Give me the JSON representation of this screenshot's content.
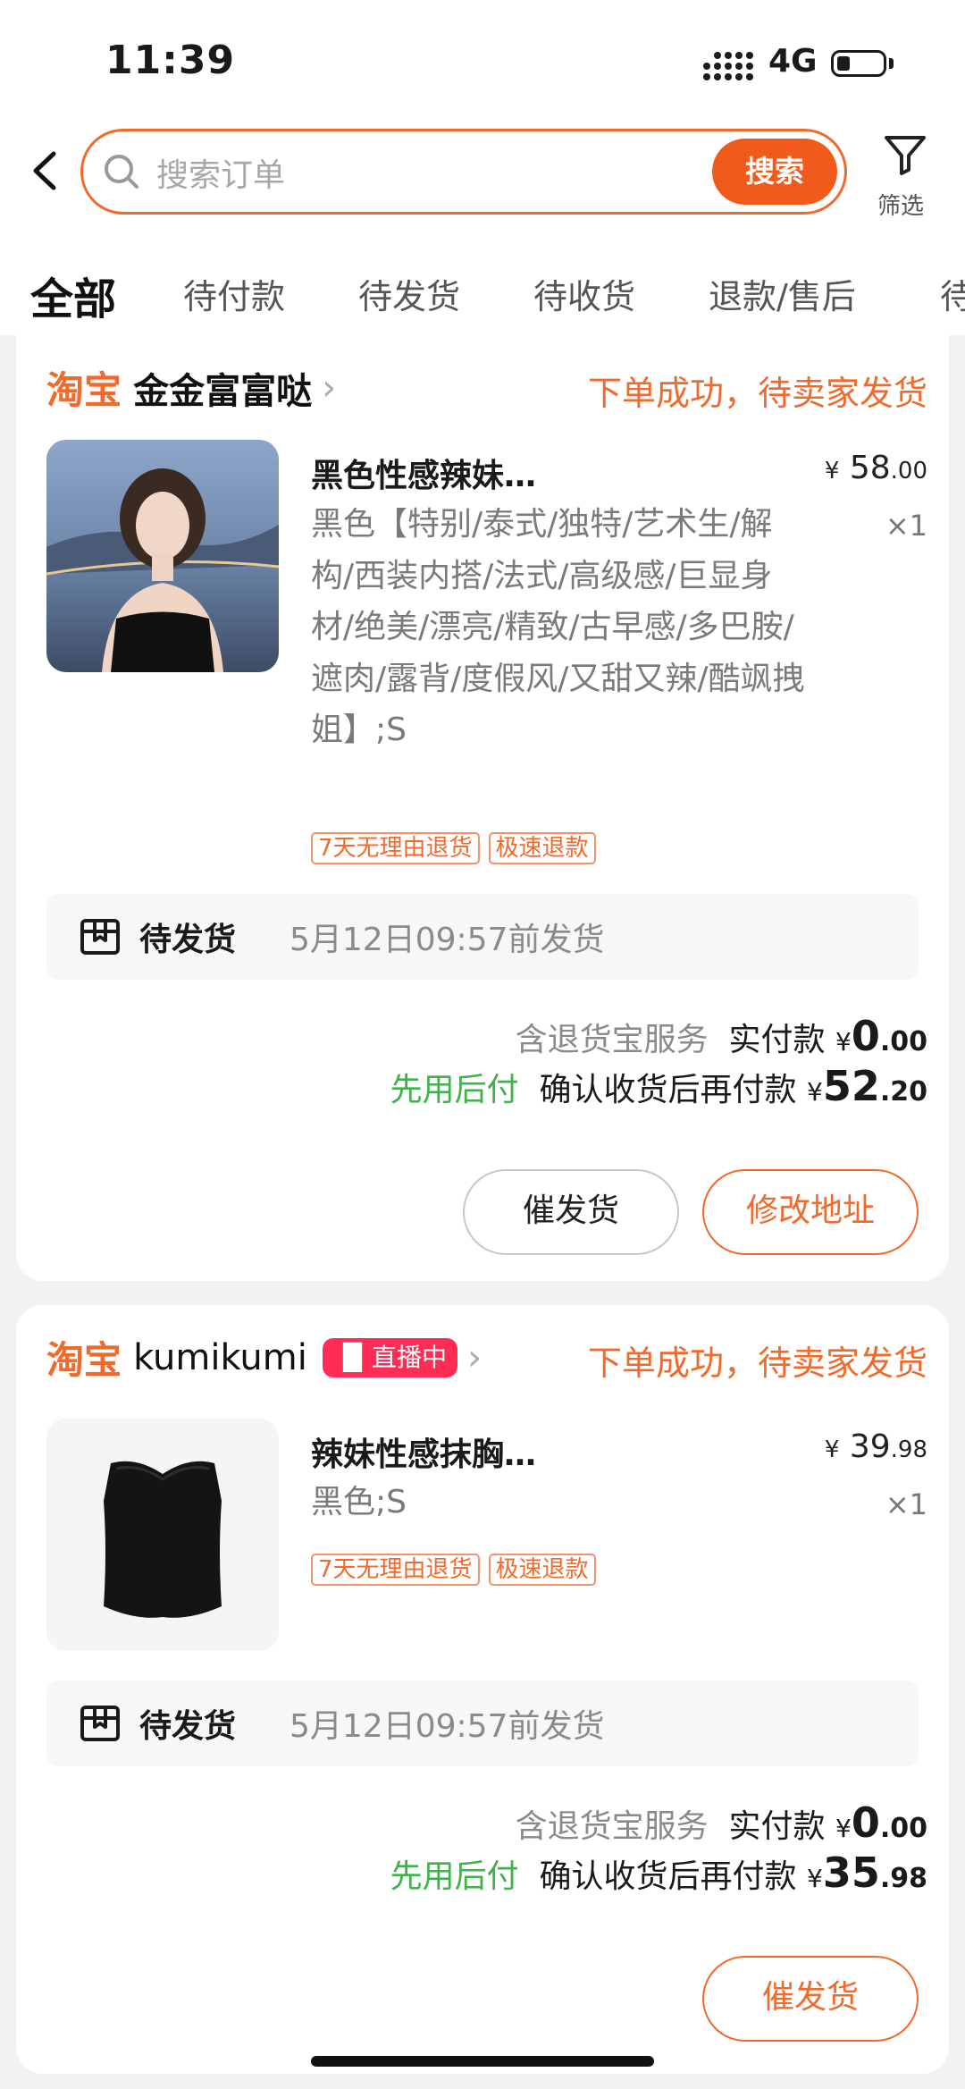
{
  "status_bar": {
    "time": "11:39",
    "network": "4G"
  },
  "search": {
    "placeholder": "搜索订单",
    "button": "搜索"
  },
  "filter_label": "筛选",
  "tabs": [
    "全部",
    "待付款",
    "待发货",
    "待收货",
    "退款/售后",
    "待"
  ],
  "orders": [
    {
      "platform": "淘宝",
      "shop": "金金富富哒",
      "live_badge": "",
      "status": "下单成功，待卖家发货",
      "title": "黑色性感辣妹抹胸背心女夏季",
      "price_currency": "¥",
      "price_int": "58",
      "price_dec": ".00",
      "qty": "×1",
      "sku": "黑色【特别/泰式/独特/艺术生/解构/西装内搭/法式/高级感/巨显身材/绝美/漂亮/精致/古早感/多巴胺/遮肉/露背/度假风/又甜又辣/酷飒拽姐】;S",
      "tags": [
        "7天无理由退货",
        "极速退款"
      ],
      "ship_status": "待发货",
      "ship_deadline": "5月12日09:57前发货",
      "service_note": "含退货宝服务",
      "paid_label": "实付款",
      "paid_int": "0",
      "paid_dec": ".00",
      "later_pay": "先用后付",
      "later_label": "确认收货后再付款",
      "later_int": "52",
      "later_dec": ".20",
      "buttons": [
        "催发货",
        "修改地址"
      ]
    },
    {
      "platform": "淘宝",
      "shop": "kumikumi",
      "live_badge": "直播中",
      "status": "下单成功，待卖家发货",
      "title": "辣妹性感抹胸黑色小背心裹胸",
      "price_currency": "¥",
      "price_int": "39",
      "price_dec": ".98",
      "qty": "×1",
      "sku": "黑色;S",
      "tags": [
        "7天无理由退货",
        "极速退款"
      ],
      "ship_status": "待发货",
      "ship_deadline": "5月12日09:57前发货",
      "service_note": "含退货宝服务",
      "paid_label": "实付款",
      "paid_int": "0",
      "paid_dec": ".00",
      "later_pay": "先用后付",
      "later_label": "确认收货后再付款",
      "later_int": "35",
      "later_dec": ".98",
      "buttons": [
        "催发货"
      ]
    }
  ],
  "colors": {
    "accent": "#f06a2c",
    "green": "#3fb24a",
    "live": "#ff2d55"
  }
}
